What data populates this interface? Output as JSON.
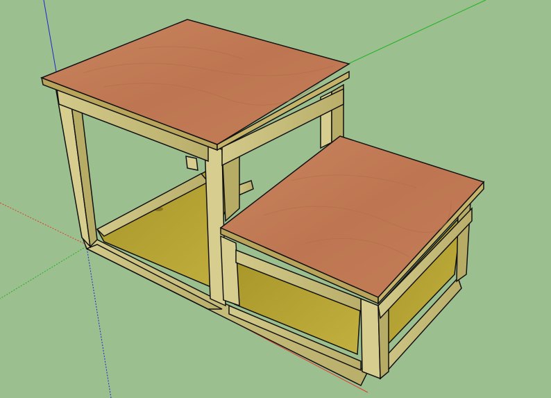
{
  "viewport": {
    "background": "#9cbf8f",
    "axis_colors": {
      "x": "#e0392b",
      "y": "#1db31d",
      "z": "#2222cc"
    }
  },
  "model": {
    "name": "two-step-stool",
    "colors": {
      "top": "#c07a55",
      "top_edge": "#b8a45a",
      "frame": "#c8c07a",
      "frame_dark": "#a99d55",
      "panel": "#b8a532",
      "panel_dark": "#9c8a24",
      "outline": "#111111"
    }
  }
}
